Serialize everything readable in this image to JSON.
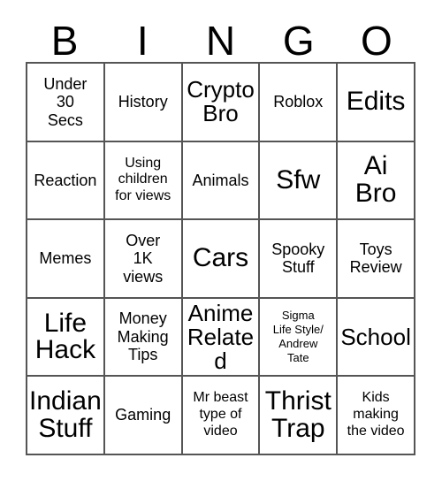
{
  "card": {
    "title": "BINGO",
    "header_letters": [
      "B",
      "I",
      "N",
      "G",
      "O"
    ],
    "grid_size": "5x5",
    "colors": {
      "background": "#ffffff",
      "text": "#000000",
      "border": "#555555"
    },
    "cells": [
      {
        "text": "Under\n30\nSecs",
        "size": "md"
      },
      {
        "text": "History",
        "size": "md"
      },
      {
        "text": "Crypto\nBro",
        "size": "lg"
      },
      {
        "text": "Roblox",
        "size": "md"
      },
      {
        "text": "Edits",
        "size": "xl"
      },
      {
        "text": "Reaction",
        "size": "md"
      },
      {
        "text": "Using\nchildren\nfor views",
        "size": "sm"
      },
      {
        "text": "Animals",
        "size": "md"
      },
      {
        "text": "Sfw",
        "size": "xl"
      },
      {
        "text": "Ai\nBro",
        "size": "xl"
      },
      {
        "text": "Memes",
        "size": "md"
      },
      {
        "text": "Over\n1K\nviews",
        "size": "md"
      },
      {
        "text": "Cars",
        "size": "xl"
      },
      {
        "text": "Spooky\nStuff",
        "size": "md"
      },
      {
        "text": "Toys\nReview",
        "size": "md"
      },
      {
        "text": "Life\nHack",
        "size": "xl"
      },
      {
        "text": "Money\nMaking\nTips",
        "size": "md"
      },
      {
        "text": "Anime\nRelated",
        "size": "lg"
      },
      {
        "text": "Sigma\nLife Style/\nAndrew\nTate",
        "size": "xs"
      },
      {
        "text": "School",
        "size": "lg"
      },
      {
        "text": "Indian\nStuff",
        "size": "xl"
      },
      {
        "text": "Gaming",
        "size": "md"
      },
      {
        "text": "Mr beast\ntype of\nvideo",
        "size": "sm"
      },
      {
        "text": "Thrist\nTrap",
        "size": "xl"
      },
      {
        "text": "Kids\nmaking\nthe video",
        "size": "sm"
      }
    ]
  }
}
